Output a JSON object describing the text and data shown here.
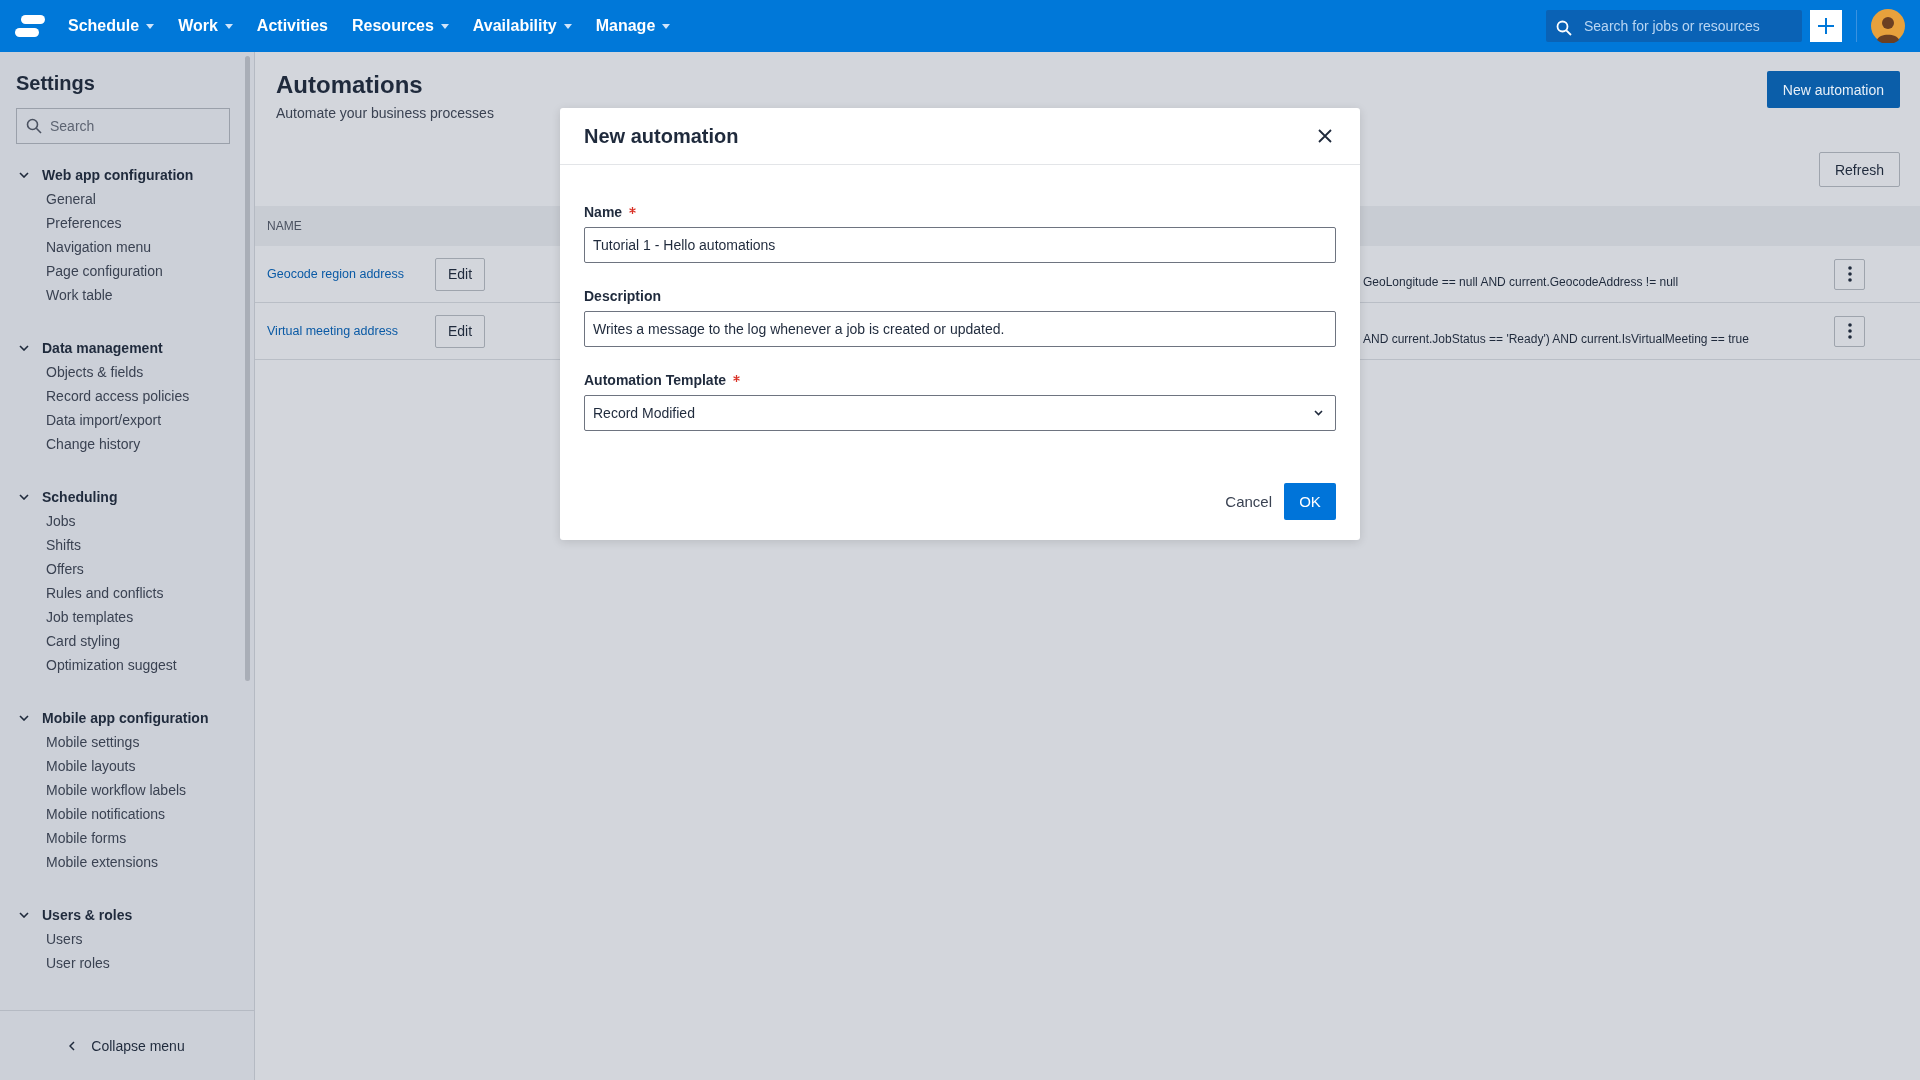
{
  "topbar": {
    "nav": [
      {
        "label": "Schedule",
        "dropdown": true
      },
      {
        "label": "Work",
        "dropdown": true
      },
      {
        "label": "Activities",
        "dropdown": false
      },
      {
        "label": "Resources",
        "dropdown": true
      },
      {
        "label": "Availability",
        "dropdown": true
      },
      {
        "label": "Manage",
        "dropdown": true
      }
    ],
    "search": {
      "placeholder": "Search for jobs or resources"
    }
  },
  "sidebar": {
    "title": "Settings",
    "search": {
      "placeholder": "Search"
    },
    "sections": [
      {
        "label": "Web app configuration",
        "expanded": true,
        "children": [
          {
            "label": "General"
          },
          {
            "label": "Preferences"
          },
          {
            "label": "Navigation menu"
          },
          {
            "label": "Page configuration"
          },
          {
            "label": "Work table"
          }
        ]
      },
      {
        "label": "Data management",
        "expanded": true,
        "children": [
          {
            "label": "Objects & fields"
          },
          {
            "label": "Record access policies"
          },
          {
            "label": "Data import/export"
          },
          {
            "label": "Change history"
          }
        ]
      },
      {
        "label": "Scheduling",
        "expanded": true,
        "children": [
          {
            "label": "Jobs"
          },
          {
            "label": "Shifts"
          },
          {
            "label": "Offers"
          },
          {
            "label": "Rules and conflicts"
          },
          {
            "label": "Job templates"
          },
          {
            "label": "Card styling"
          },
          {
            "label": "Optimization suggest"
          }
        ]
      },
      {
        "label": "Mobile app configuration",
        "expanded": true,
        "children": [
          {
            "label": "Mobile settings"
          },
          {
            "label": "Mobile layouts"
          },
          {
            "label": "Mobile workflow labels"
          },
          {
            "label": "Mobile notifications"
          },
          {
            "label": "Mobile forms"
          },
          {
            "label": "Mobile extensions"
          }
        ]
      },
      {
        "label": "Users & roles",
        "expanded": true,
        "children": [
          {
            "label": "Users"
          },
          {
            "label": "User roles"
          }
        ]
      }
    ],
    "collapse": "Collapse menu"
  },
  "page": {
    "title": "Automations",
    "subtitle": "Automate your business processes",
    "new_button": "New automation",
    "refresh_button": "Refresh"
  },
  "table": {
    "columns": [
      "NAME"
    ],
    "rows": [
      {
        "name": "Geocode region address",
        "edit": "Edit",
        "condition": "GeoLongitude == null AND current.GeocodeAddress != null"
      },
      {
        "name": "Virtual meeting address",
        "edit": "Edit",
        "condition": "AND current.JobStatus == 'Ready') AND current.IsVirtualMeeting == true"
      }
    ]
  },
  "dialog": {
    "title": "New automation",
    "fields": [
      {
        "kind": "text",
        "label": "Name",
        "required": true,
        "value": "Tutorial 1 - Hello automations"
      },
      {
        "kind": "text",
        "label": "Description",
        "required": false,
        "value": "Writes a message to the log whenever a job is created or updated."
      },
      {
        "kind": "select",
        "label": "Automation Template",
        "required": true,
        "value": "Record Modified"
      }
    ],
    "cancel": "Cancel",
    "ok": "OK"
  }
}
